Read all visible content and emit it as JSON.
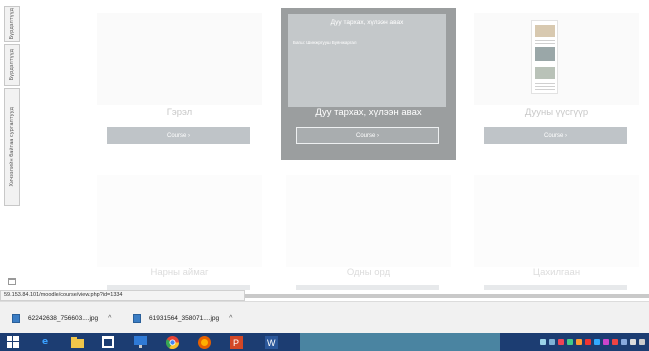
{
  "sidebar_tabs": [
    {
      "label": "Бүрдэлтүүд"
    },
    {
      "label": "Бүрдэлтүүд"
    },
    {
      "label": "Хичээлийн байгаа сургалтууд"
    }
  ],
  "cards": [
    {
      "title": "Гэрэл",
      "button": "Course ›"
    },
    {
      "title": "Дуу тархах, хүлээн авах",
      "button": "Course ›",
      "overlay_title": "Дуу тархах, хүлээн авах",
      "overlay_subtitle": "Багш: Шинжргууш Буянжаргал"
    },
    {
      "title": "Дууны үүсгүүр",
      "button": "Course ›"
    },
    {
      "title": "Нарны аймаг"
    },
    {
      "title": "Одны орд"
    },
    {
      "title": "Цахилгаан"
    }
  ],
  "status_url": "59.153.84.101/moodle/course/view.php?id=1334",
  "downloads": [
    {
      "filename": "62242638_756603....jpg",
      "chevron": "^"
    },
    {
      "filename": "61931564_358071....jpg",
      "chevron": "^"
    }
  ],
  "taskbar": {
    "icons": [
      "windows-start-icon",
      "edge-browser-icon",
      "file-explorer-icon",
      "store-icon",
      "display-icon",
      "chrome-icon",
      "firefox-icon",
      "powerpoint-icon",
      "word-icon"
    ]
  },
  "colors": {
    "active_card": "#9b9e9f",
    "button": "#bfc4c8",
    "taskbar": "#1c3d72"
  }
}
